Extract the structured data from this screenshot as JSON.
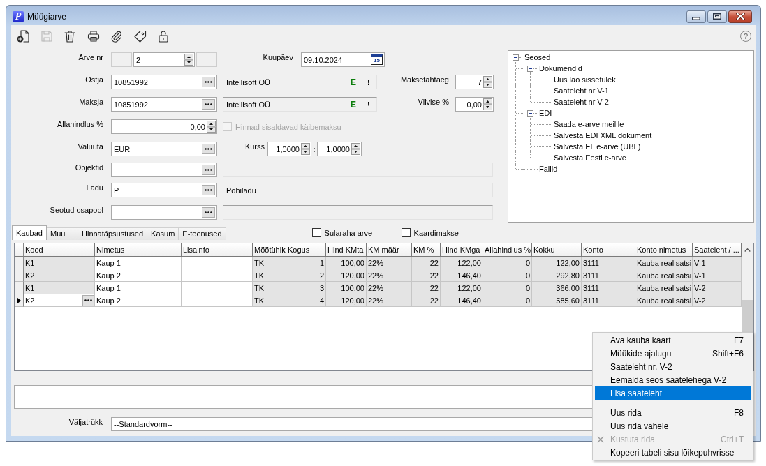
{
  "window": {
    "title": "Müügiarve",
    "icon_letter": "P"
  },
  "toolbar": {
    "buttons": [
      {
        "disabled": false
      },
      {
        "disabled": true
      },
      {
        "disabled": false
      },
      {
        "disabled": false
      },
      {
        "disabled": false
      },
      {
        "disabled": false
      },
      {
        "disabled": false
      }
    ],
    "help": "?"
  },
  "form": {
    "invoice_no": {
      "label": "Arve nr",
      "value": "2"
    },
    "date": {
      "label": "Kuupäev",
      "value": "09.10.2024",
      "calendar_button": "15"
    },
    "buyer": {
      "label": "Ostja",
      "code": "10851992",
      "name": "Intellisoft OÜ",
      "einvoice": "E",
      "warning": "!"
    },
    "payment_term": {
      "label": "Maksetähtaeg",
      "value": "7"
    },
    "payer": {
      "label": "Maksja",
      "code": "10851992",
      "name": "Intellisoft OÜ",
      "einvoice": "E",
      "warning": "!"
    },
    "penalty": {
      "label": "Viivise %",
      "value": "0,00"
    },
    "discount": {
      "label": "Allahindlus %",
      "value": "0,00"
    },
    "vat_included": {
      "label": "Hinnad sisaldavad käibemaksu",
      "checked": false,
      "disabled": true
    },
    "currency": {
      "label": "Valuuta",
      "value": "EUR"
    },
    "rate": {
      "label": "Kurss",
      "value": "1,0000",
      "separator": ":",
      "value2": "1,0000"
    },
    "lookups": [
      {
        "label": "Objektid"
      },
      {
        "label": "Ladu",
        "code": "P",
        "name": "Põhiladu"
      },
      {
        "label": "Seotud osapool"
      }
    ]
  },
  "tree": {
    "nodes": [
      {
        "label": "Seosed",
        "expanded": true,
        "children": [
          {
            "label": "Dokumendid",
            "expanded": true,
            "children": [
              {
                "label": "Uus lao sissetulek"
              },
              {
                "label": "Saateleht nr V-1"
              },
              {
                "label": "Saateleht nr V-2"
              }
            ]
          },
          {
            "label": "EDI",
            "expanded": true,
            "children": [
              {
                "label": "Saada e-arve meilile"
              },
              {
                "label": "Salvesta EDI XML dokument"
              },
              {
                "label": "Salvesta EL e-arve (UBL)"
              },
              {
                "label": "Salvesta Eesti e-arve"
              }
            ]
          },
          {
            "label": "Failid"
          }
        ]
      }
    ]
  },
  "tabs": [
    {
      "label": "Kaubad",
      "selected": true
    },
    {
      "label": "Muu",
      "selected": false
    },
    {
      "label": "Hinnatäpsustused",
      "selected": false
    },
    {
      "label": "Kasum",
      "selected": false
    },
    {
      "label": "E-teenused",
      "selected": false
    }
  ],
  "options": [
    {
      "label": "Sularaha arve",
      "checked": false
    },
    {
      "label": "Kaardimakse",
      "checked": false
    }
  ],
  "grid": {
    "columns": [
      {
        "label": "Kood",
        "kind": "text",
        "shaded": true
      },
      {
        "label": "Nimetus",
        "kind": "text",
        "shaded": false
      },
      {
        "label": "Lisainfo",
        "kind": "text",
        "shaded": false
      },
      {
        "label": "Mõõtühik",
        "kind": "text",
        "shaded": true
      },
      {
        "label": "Kogus",
        "kind": "number",
        "shaded": true
      },
      {
        "label": "Hind KMta",
        "kind": "number",
        "shaded": true
      },
      {
        "label": "KM määr",
        "kind": "text",
        "shaded": true
      },
      {
        "label": "KM %",
        "kind": "number",
        "shaded": true
      },
      {
        "label": "Hind KMga",
        "kind": "number",
        "shaded": true
      },
      {
        "label": "Allahindlus %",
        "kind": "number",
        "shaded": true
      },
      {
        "label": "Kokku",
        "kind": "number",
        "shaded": true
      },
      {
        "label": "Konto",
        "kind": "text",
        "shaded": true
      },
      {
        "label": "Konto nimetus",
        "kind": "text",
        "shaded": true
      },
      {
        "label": "Saateleht / ...",
        "kind": "text",
        "shaded": true
      }
    ],
    "rows": [
      {
        "current": false,
        "code": "K1",
        "name": "Kaup 1",
        "unit": "TK",
        "quantity": "1",
        "price_net": "100,00",
        "vat_rate": "22%",
        "vat_percent": "22",
        "price_gross": "122,00",
        "discount": "0",
        "total": "122,00",
        "account": "3111",
        "account_name": "Kauba realisatsi",
        "delivery_note": "V-1"
      },
      {
        "current": false,
        "code": "K2",
        "name": "Kaup 2",
        "unit": "TK",
        "quantity": "2",
        "price_net": "120,00",
        "vat_rate": "22%",
        "vat_percent": "22",
        "price_gross": "146,40",
        "discount": "0",
        "total": "292,80",
        "account": "3111",
        "account_name": "Kauba realisatsi",
        "delivery_note": "V-1"
      },
      {
        "current": false,
        "code": "K1",
        "name": "Kaup 1",
        "unit": "TK",
        "quantity": "3",
        "price_net": "100,00",
        "vat_rate": "22%",
        "vat_percent": "22",
        "price_gross": "122,00",
        "discount": "0",
        "total": "366,00",
        "account": "3111",
        "account_name": "Kauba realisatsi",
        "delivery_note": "V-2"
      },
      {
        "current": true,
        "code": "K2",
        "name": "Kaup 2",
        "unit": "TK",
        "quantity": "4",
        "price_net": "120,00",
        "vat_rate": "22%",
        "vat_percent": "22",
        "price_gross": "146,40",
        "discount": "0",
        "total": "585,60",
        "account": "3111",
        "account_name": "Kauba realisatsi",
        "delivery_note": "V-2"
      }
    ]
  },
  "output": {
    "label": "Väljatrükk",
    "value": "--Standardvorm--"
  },
  "context_menu": {
    "items": [
      {
        "kind": "item",
        "label": "Ava kauba kaart",
        "shortcut": "F7",
        "selected": false,
        "disabled": false,
        "icon": false
      },
      {
        "kind": "item",
        "label": "Müükide ajalugu",
        "shortcut": "Shift+F6",
        "selected": false,
        "disabled": false,
        "icon": false
      },
      {
        "kind": "item",
        "label": "Saateleht nr. V-2",
        "selected": false,
        "disabled": false,
        "icon": false
      },
      {
        "kind": "item",
        "label": "Eemalda seos saatelehega V-2",
        "selected": false,
        "disabled": false,
        "icon": false
      },
      {
        "kind": "item",
        "label": "Lisa saateleht",
        "selected": true,
        "disabled": false,
        "icon": false
      },
      {
        "kind": "separator"
      },
      {
        "kind": "item",
        "label": "Uus rida",
        "shortcut": "F8",
        "selected": false,
        "disabled": false,
        "icon": false
      },
      {
        "kind": "item",
        "label": "Uus rida vahele",
        "selected": false,
        "disabled": false,
        "icon": false
      },
      {
        "kind": "item",
        "label": "Kustuta rida",
        "shortcut": "Ctrl+T",
        "selected": false,
        "disabled": true,
        "icon": true
      },
      {
        "kind": "item",
        "label": "Kopeeri tabeli sisu lõikepuhvrisse",
        "selected": false,
        "disabled": false,
        "icon": false
      }
    ]
  }
}
